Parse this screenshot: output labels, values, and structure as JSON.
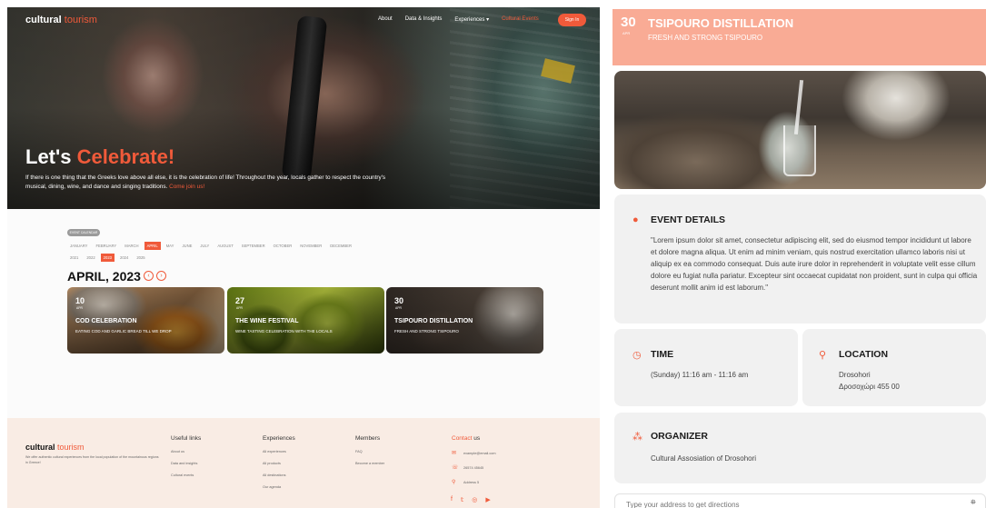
{
  "left": {
    "nav": {
      "logo_main": "cultural",
      "logo_accent": "tourism",
      "links": [
        "About",
        "Data & Insights",
        "Experiences",
        "Cultural Events"
      ],
      "experiences_arrow": "▾",
      "signin": "Sign In"
    },
    "hero": {
      "title_main": "Let's",
      "title_accent": "Celebrate!",
      "text": "If there is one thing that the Greeks love above all else, it is the celebration of life! Throughout the year, locals gather to respect the country's musical, dining, wine, and dance and singing traditions.",
      "join": "Come join us!"
    },
    "calendar": {
      "badge": "EVENT CALENDAR",
      "months": [
        "JANUARY",
        "FEBRUARY",
        "MARCH",
        "APRIL",
        "MAY",
        "JUNE",
        "JULY",
        "AUGUST",
        "SEPTEMBER",
        "OCTOBER",
        "NOVEMBER",
        "DECEMBER"
      ],
      "selected_month": "APRIL",
      "years": [
        "2021",
        "2022",
        "2023",
        "2024",
        "2025"
      ],
      "selected_year": "2023",
      "heading": "APRIL, 2023",
      "prev_arrow": "‹",
      "next_arrow": "›",
      "cards": [
        {
          "day": "10",
          "month": "APR",
          "title": "COD CELEBRATION",
          "subtitle": "EATING COD AND GARLIC BREAD TILL WE DROP"
        },
        {
          "day": "27",
          "month": "APR",
          "title": "THE WINE FESTIVAL",
          "subtitle": "WINE TASTING CELEBRATION WITH THE LOCALS"
        },
        {
          "day": "30",
          "month": "APR",
          "title": "TSIPOURO DISTILLATION",
          "subtitle": "FRESH AND STRONG TSIPOURO"
        }
      ]
    },
    "footer": {
      "logo_main": "cultural",
      "logo_accent": "tourism",
      "description": "We offer authentic cultural experiences from the local population of the mountainous regions in Greece!",
      "useful_links": {
        "heading": "Useful links",
        "items": [
          "About us",
          "Data and insights",
          "Cultural events"
        ]
      },
      "experiences": {
        "heading": "Experiences",
        "items": [
          "All experiences",
          "All products",
          "All destinations",
          "Our agenda"
        ]
      },
      "members": {
        "heading": "Members",
        "items": [
          "FAQ",
          "Become a member"
        ]
      },
      "contact": {
        "heading_accent": "Contact",
        "heading_main": "us",
        "items": [
          {
            "icon": "✉",
            "icon_name": "mail-icon",
            "text": "example@email.com"
          },
          {
            "icon": "☏",
            "icon_name": "phone-icon",
            "text": "26574 45645"
          },
          {
            "icon": "⚲",
            "icon_name": "location-icon",
            "text": "Address 5"
          }
        ]
      },
      "socials": [
        {
          "glyph": "f",
          "name": "facebook-icon"
        },
        {
          "glyph": "𝕥",
          "name": "twitter-icon"
        },
        {
          "glyph": "◎",
          "name": "instagram-icon"
        },
        {
          "glyph": "▶",
          "name": "youtube-icon"
        }
      ]
    }
  },
  "right": {
    "header": {
      "day": "30",
      "month": "APR",
      "title": "TSIPOURO DISTILLATION",
      "subtitle": "FRESH AND STRONG TSIPOURO"
    },
    "details": {
      "icon": "●",
      "title": "EVENT DETAILS",
      "text": "\"Lorem ipsum dolor sit amet, consectetur adipiscing elit, sed do eiusmod tempor incididunt ut labore et dolore magna aliqua. Ut enim ad minim veniam, quis nostrud exercitation ullamco laboris nisi ut aliquip ex ea commodo consequat. Duis aute irure dolor in reprehenderit in voluptate velit esse cillum dolore eu fugiat nulla pariatur. Excepteur sint occaecat cupidatat non proident, sunt in culpa qui officia deserunt mollit anim id est laborum.\""
    },
    "time": {
      "icon": "◷",
      "title": "TIME",
      "text": "(Sunday) 11:16 am - 11:16 am"
    },
    "location": {
      "icon": "⚲",
      "title": "LOCATION",
      "line1": "Drosohori",
      "line2": "Δροσοχώρι 455 00"
    },
    "organizer": {
      "icon": "⁂",
      "title": "ORGANIZER",
      "text": "Cultural Assosiation of Drosohori"
    },
    "address_input": {
      "placeholder": "Type your address to get directions",
      "icon": "⛯"
    }
  }
}
